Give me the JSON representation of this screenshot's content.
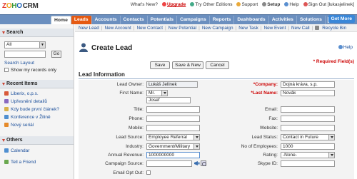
{
  "header": {
    "logo_letters": [
      "Z",
      "O",
      "H",
      "O"
    ],
    "logo_suffix": "CRM",
    "links": {
      "whats_new": "What's New?",
      "upgrade": "Upgrade",
      "try_other": "Try Other Editions",
      "support": "Support",
      "setup": "Setup",
      "help": "Help",
      "signout": "Sign Out [lukasjelinek]"
    }
  },
  "tabs": [
    "Home",
    "Leads",
    "Accounts",
    "Contacts",
    "Potentials",
    "Campaigns",
    "Reports",
    "Dashboards",
    "Activities",
    "Solutions"
  ],
  "active_tab": "Leads",
  "get_more": "Get More",
  "sidebar": {
    "search": {
      "header": "Search",
      "select_value": "All",
      "go_label": "Go",
      "layout_link": "Search Layout",
      "show_mine": "Show my records only"
    },
    "recent": {
      "header": "Recent Items",
      "items": [
        "Liberix, o.p.s.",
        "Upřesnění detailů",
        "Kdy bude první článek?",
        "Konference v Žilině",
        "Nový seriál"
      ]
    },
    "others": {
      "header": "Others",
      "items": [
        "Calendar",
        "Tell a Friend"
      ]
    }
  },
  "quicklinks": [
    "New Lead",
    "New Account",
    "New Contact",
    "New Potential",
    "New Campaign",
    "New Task",
    "New Event",
    "New Call",
    "Recycle Bin"
  ],
  "page": {
    "title": "Create Lead",
    "help": "Help",
    "required_note": "* Required Field(s)",
    "buttons": {
      "save": "Save",
      "save_new": "Save & New",
      "cancel": "Cancel"
    },
    "section": "Lead Information"
  },
  "form": {
    "left": {
      "lead_owner": {
        "label": "Lead Owner:",
        "value": "Lukáš Jelínek"
      },
      "first_name": {
        "label": "First Name:",
        "salutation": "Mr.",
        "value": "Josef"
      },
      "title": {
        "label": "Title:",
        "value": ""
      },
      "phone": {
        "label": "Phone:",
        "value": ""
      },
      "mobile": {
        "label": "Mobile:",
        "value": ""
      },
      "lead_source": {
        "label": "Lead Source:",
        "value": "Employee Referral"
      },
      "industry": {
        "label": "Industry:",
        "value": "Government/Military"
      },
      "annual_revenue": {
        "label": "Annual Revenue:",
        "value": "1000000000"
      },
      "campaign_source": {
        "label": "Campaign Source:",
        "value": ""
      },
      "email_opt_out": {
        "label": "Email Opt Out:"
      }
    },
    "right": {
      "company": {
        "label": "*Company:",
        "value": "Dojná kráva, s.p."
      },
      "last_name": {
        "label": "*Last Name:",
        "value": "Novák"
      },
      "email": {
        "label": "Email:",
        "value": ""
      },
      "fax": {
        "label": "Fax:",
        "value": ""
      },
      "website": {
        "label": "Website:",
        "value": ""
      },
      "lead_status": {
        "label": "Lead Status:",
        "value": "Contact in Future"
      },
      "no_of_employees": {
        "label": "No of Employees:",
        "value": "1000"
      },
      "rating": {
        "label": "Rating:",
        "value": "-None-"
      },
      "skype_id": {
        "label": "Skype ID:",
        "value": ""
      }
    }
  },
  "colors": {
    "active_tab": "#e65a12",
    "tabbar": "#6b8fbf",
    "required": "#cc0000",
    "link": "#1a4e9a"
  }
}
